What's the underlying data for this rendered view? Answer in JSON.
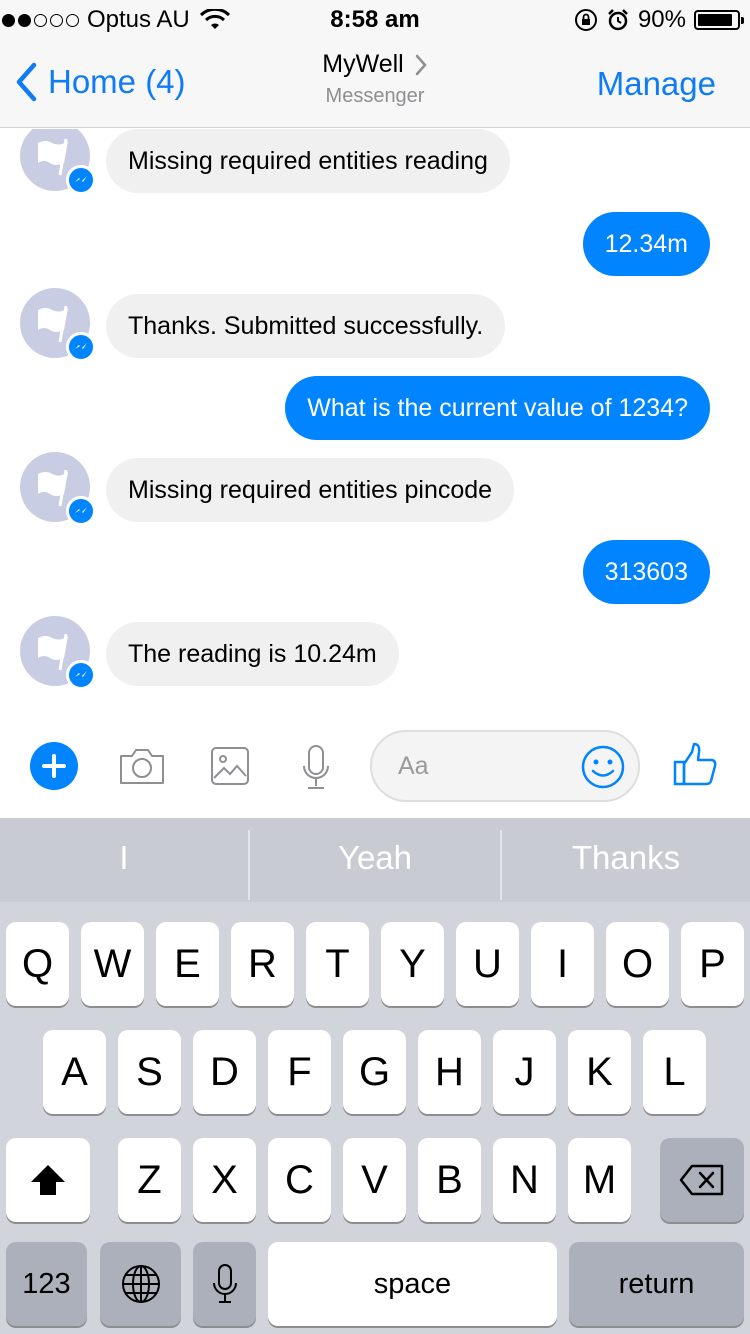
{
  "status_bar": {
    "carrier": "Optus AU",
    "time": "8:58 am",
    "battery_percent": "90%",
    "battery_level": 0.9,
    "signal_bars_filled": 2,
    "signal_bars_total": 5
  },
  "nav": {
    "back_label": "Home (4)",
    "title": "MyWell",
    "subtitle": "Messenger",
    "manage_label": "Manage"
  },
  "messages": [
    {
      "direction": "in",
      "text": "Missing required entities reading"
    },
    {
      "direction": "out",
      "text": "12.34m"
    },
    {
      "direction": "in",
      "text": "Thanks. Submitted successfully."
    },
    {
      "direction": "out",
      "text": "What is the current value of 1234?"
    },
    {
      "direction": "in",
      "text": "Missing required entities pincode"
    },
    {
      "direction": "out",
      "text": "313603"
    },
    {
      "direction": "in",
      "text": "The reading is 10.24m"
    }
  ],
  "composer": {
    "placeholder": "Aa",
    "icons": [
      "plus-icon",
      "camera-icon",
      "image-icon",
      "microphone-icon",
      "emoji-icon",
      "thumbs-up-icon"
    ]
  },
  "keyboard": {
    "suggestions": [
      "I",
      "Yeah",
      "Thanks"
    ],
    "row1": [
      "Q",
      "W",
      "E",
      "R",
      "T",
      "Y",
      "U",
      "I",
      "O",
      "P"
    ],
    "row2": [
      "A",
      "S",
      "D",
      "F",
      "G",
      "H",
      "J",
      "K",
      "L"
    ],
    "row3": [
      "Z",
      "X",
      "C",
      "V",
      "B",
      "N",
      "M"
    ],
    "numbers_label": "123",
    "space_label": "space",
    "return_label": "return"
  },
  "colors": {
    "accent": "#0084ff",
    "link": "#0f7cf6",
    "incoming_bubble": "#f1f0f0",
    "keyboard_bg": "#d1d5db"
  }
}
